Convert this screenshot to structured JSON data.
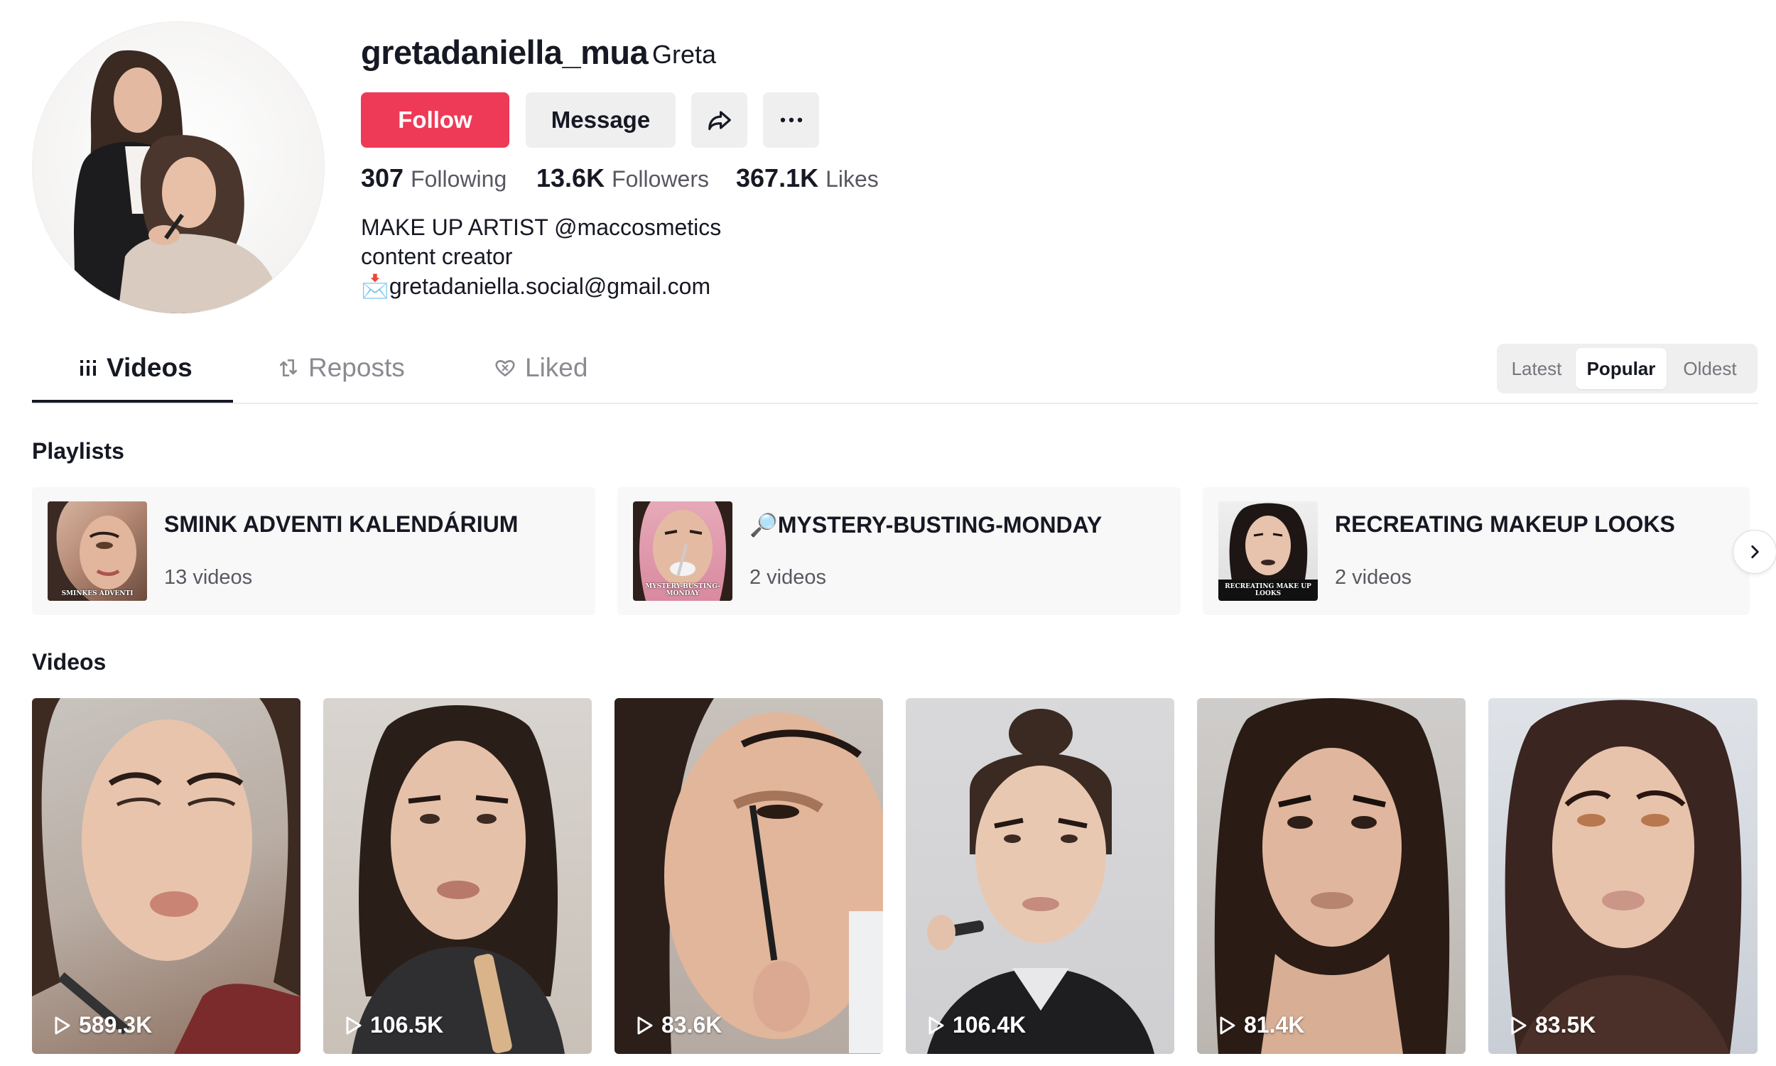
{
  "profile": {
    "username": "gretadaniella_mua",
    "nickname": "Greta",
    "follow_label": "Follow",
    "message_label": "Message",
    "share_icon": "share-icon",
    "more_icon": "more-icon",
    "stats": [
      {
        "value": "307",
        "label": "Following"
      },
      {
        "value": "13.6K",
        "label": "Followers"
      },
      {
        "value": "367.1K",
        "label": "Likes"
      }
    ],
    "bio": [
      "MAKE UP ARTIST @maccosmetics",
      "content creator",
      "📩gretadaniella.social@gmail.com"
    ]
  },
  "tabs": [
    {
      "label": "Videos",
      "icon": "grid-icon",
      "active": true
    },
    {
      "label": "Reposts",
      "icon": "repost-icon",
      "active": false
    },
    {
      "label": "Liked",
      "icon": "heart-icon",
      "active": false
    }
  ],
  "sort": {
    "options": [
      "Latest",
      "Popular",
      "Oldest"
    ],
    "selected": "Popular"
  },
  "playlists": {
    "title": "Playlists",
    "items": [
      {
        "title": "SMINK ADVENTI KALENDÁRIUM",
        "count": "13 videos",
        "thumb_text": "SMINKES ADVENTI"
      },
      {
        "title": "🔎MYSTERY-BUSTING-MONDAY",
        "count": "2 videos",
        "thumb_text": "MYSTERY-BUSTING-MONDAY"
      },
      {
        "title": "RECREATING MAKEUP LOOKS",
        "count": "2 videos",
        "thumb_text": "RECREATING MAKE UP LOOKS"
      }
    ],
    "next_icon": "chevron-right-icon"
  },
  "videos": {
    "title": "Videos",
    "items": [
      {
        "views": "589.3K"
      },
      {
        "views": "106.5K"
      },
      {
        "views": "83.6K"
      },
      {
        "views": "106.4K"
      },
      {
        "views": "81.4K"
      },
      {
        "views": "83.5K"
      }
    ]
  },
  "colors": {
    "follow": "#ee3a57",
    "text": "#161823",
    "secondary_text": "#575861",
    "button_bg": "#efeff0"
  }
}
